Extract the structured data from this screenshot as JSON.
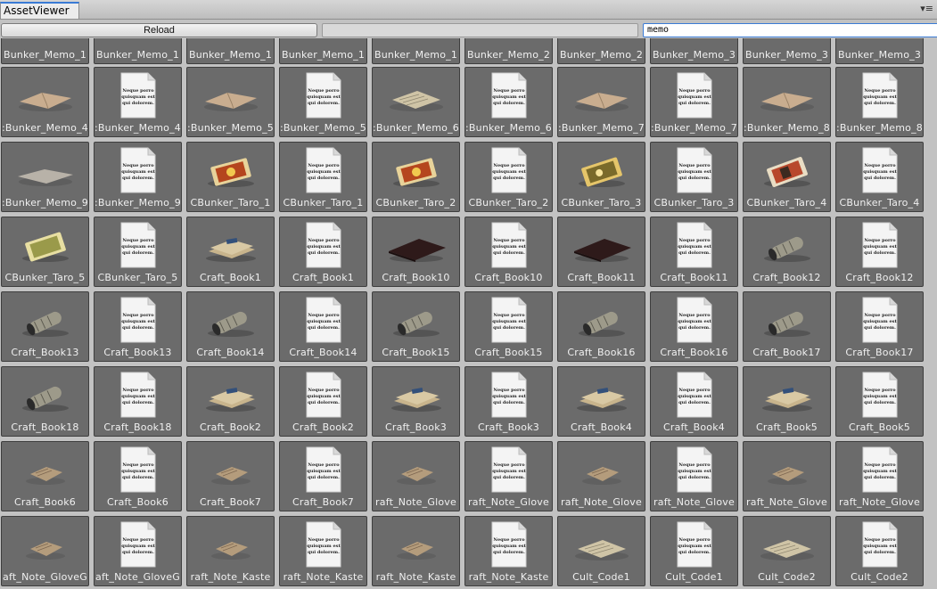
{
  "window": {
    "tab_title": "AssetViewer",
    "menu_icon": "menu-icon"
  },
  "toolbar": {
    "reload_label": "Reload",
    "middle_value": "",
    "search_value": "memo"
  },
  "grid": {
    "rows": [
      [
        {
          "label": "Bunker_Memo_1",
          "kind": "partial"
        },
        {
          "label": "Bunker_Memo_1",
          "kind": "partial"
        },
        {
          "label": "Bunker_Memo_1",
          "kind": "partial"
        },
        {
          "label": "Bunker_Memo_1",
          "kind": "partial"
        },
        {
          "label": "Bunker_Memo_1",
          "kind": "partial"
        },
        {
          "label": "Bunker_Memo_2",
          "kind": "partial"
        },
        {
          "label": "Bunker_Memo_2",
          "kind": "partial"
        },
        {
          "label": "Bunker_Memo_3",
          "kind": "partial"
        },
        {
          "label": "Bunker_Memo_3",
          "kind": "partial"
        },
        {
          "label": "Bunker_Memo_3",
          "kind": "partial"
        }
      ],
      [
        {
          "label": ":Bunker_Memo_4",
          "kind": "paper"
        },
        {
          "label": ":Bunker_Memo_4",
          "kind": "doc"
        },
        {
          "label": ":Bunker_Memo_5",
          "kind": "paper"
        },
        {
          "label": ":Bunker_Memo_5",
          "kind": "doc"
        },
        {
          "label": ":Bunker_Memo_6",
          "kind": "paper2"
        },
        {
          "label": ":Bunker_Memo_6",
          "kind": "doc"
        },
        {
          "label": ":Bunker_Memo_7",
          "kind": "paper"
        },
        {
          "label": ":Bunker_Memo_7",
          "kind": "doc"
        },
        {
          "label": ":Bunker_Memo_8",
          "kind": "paper"
        },
        {
          "label": ":Bunker_Memo_8",
          "kind": "doc"
        }
      ],
      [
        {
          "label": ":Bunker_Memo_9",
          "kind": "paper3"
        },
        {
          "label": ":Bunker_Memo_9",
          "kind": "doc"
        },
        {
          "label": "CBunker_Taro_1",
          "kind": "taro"
        },
        {
          "label": "CBunker_Taro_1",
          "kind": "doc"
        },
        {
          "label": "CBunker_Taro_2",
          "kind": "taro"
        },
        {
          "label": "CBunker_Taro_2",
          "kind": "doc"
        },
        {
          "label": "CBunker_Taro_3",
          "kind": "taro2"
        },
        {
          "label": "CBunker_Taro_3",
          "kind": "doc"
        },
        {
          "label": "CBunker_Taro_4",
          "kind": "taro3"
        },
        {
          "label": "CBunker_Taro_4",
          "kind": "doc"
        }
      ],
      [
        {
          "label": "CBunker_Taro_5",
          "kind": "taro4"
        },
        {
          "label": "CBunker_Taro_5",
          "kind": "doc"
        },
        {
          "label": "Craft_Book1",
          "kind": "bundle"
        },
        {
          "label": "Craft_Book1",
          "kind": "doc"
        },
        {
          "label": "Craft_Book10",
          "kind": "darkbook"
        },
        {
          "label": "Craft_Book10",
          "kind": "doc"
        },
        {
          "label": "Craft_Book11",
          "kind": "darkbook"
        },
        {
          "label": "Craft_Book11",
          "kind": "doc"
        },
        {
          "label": "Craft_Book12",
          "kind": "scroll"
        },
        {
          "label": "Craft_Book12",
          "kind": "doc"
        }
      ],
      [
        {
          "label": "Craft_Book13",
          "kind": "scroll"
        },
        {
          "label": "Craft_Book13",
          "kind": "doc"
        },
        {
          "label": "Craft_Book14",
          "kind": "scroll"
        },
        {
          "label": "Craft_Book14",
          "kind": "doc"
        },
        {
          "label": "Craft_Book15",
          "kind": "scroll"
        },
        {
          "label": "Craft_Book15",
          "kind": "doc"
        },
        {
          "label": "Craft_Book16",
          "kind": "scroll"
        },
        {
          "label": "Craft_Book16",
          "kind": "doc"
        },
        {
          "label": "Craft_Book17",
          "kind": "scroll"
        },
        {
          "label": "Craft_Book17",
          "kind": "doc"
        }
      ],
      [
        {
          "label": "Craft_Book18",
          "kind": "scroll"
        },
        {
          "label": "Craft_Book18",
          "kind": "doc"
        },
        {
          "label": "Craft_Book2",
          "kind": "bundle"
        },
        {
          "label": "Craft_Book2",
          "kind": "doc"
        },
        {
          "label": "Craft_Book3",
          "kind": "bundle"
        },
        {
          "label": "Craft_Book3",
          "kind": "doc"
        },
        {
          "label": "Craft_Book4",
          "kind": "bundle"
        },
        {
          "label": "Craft_Book4",
          "kind": "doc"
        },
        {
          "label": "Craft_Book5",
          "kind": "bundle"
        },
        {
          "label": "Craft_Book5",
          "kind": "doc"
        }
      ],
      [
        {
          "label": "Craft_Book6",
          "kind": "note"
        },
        {
          "label": "Craft_Book6",
          "kind": "doc"
        },
        {
          "label": "Craft_Book7",
          "kind": "note"
        },
        {
          "label": "Craft_Book7",
          "kind": "doc"
        },
        {
          "label": "raft_Note_Glove",
          "kind": "note"
        },
        {
          "label": "raft_Note_Glove",
          "kind": "doc"
        },
        {
          "label": "raft_Note_Glove",
          "kind": "note"
        },
        {
          "label": "raft_Note_Glove",
          "kind": "doc"
        },
        {
          "label": "raft_Note_Glove",
          "kind": "note"
        },
        {
          "label": "raft_Note_Glove",
          "kind": "doc"
        }
      ],
      [
        {
          "label": "aft_Note_GloveG",
          "kind": "note"
        },
        {
          "label": "aft_Note_GloveG",
          "kind": "doc"
        },
        {
          "label": "raft_Note_Kaste",
          "kind": "note"
        },
        {
          "label": "raft_Note_Kaste",
          "kind": "doc"
        },
        {
          "label": "raft_Note_Kaste",
          "kind": "note"
        },
        {
          "label": "raft_Note_Kaste",
          "kind": "doc"
        },
        {
          "label": "Cult_Code1",
          "kind": "paper2"
        },
        {
          "label": "Cult_Code1",
          "kind": "doc"
        },
        {
          "label": "Cult_Code2",
          "kind": "paper2"
        },
        {
          "label": "Cult_Code2",
          "kind": "doc"
        }
      ]
    ]
  },
  "doc_icon_text": [
    "Neque porro",
    "quisquam est",
    "qui dolorem."
  ],
  "colors": {
    "cell_bg": "#6b6b6b",
    "accent": "#3a7bd5"
  }
}
